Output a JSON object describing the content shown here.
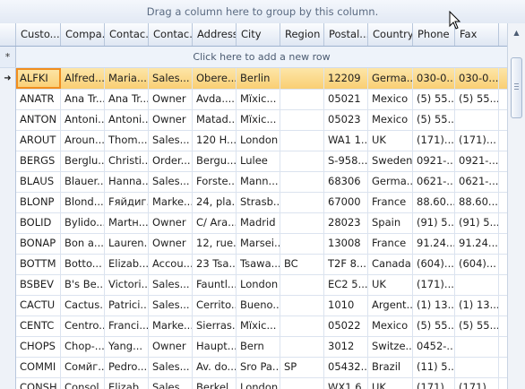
{
  "group_panel_text": "Drag a column here to group by this column.",
  "new_row_text": "Click here to add a new row",
  "new_row_symbol": "*",
  "current_row_symbol": "➜",
  "columns": [
    "Custo...",
    "Compa...",
    "Contac...",
    "Contac...",
    "Address",
    "City",
    "Region",
    "Postal...",
    "Country",
    "Phone",
    "Fax"
  ],
  "rows": [
    [
      "ALFKI",
      "Alfred...",
      "Maria...",
      "Sales...",
      "Obere...",
      "Berlin",
      "",
      "12209",
      "Germa...",
      "030-0...",
      "030-0..."
    ],
    [
      "ANATR",
      "Ana Tr...",
      "Ana Tr...",
      "Owner",
      "Avda....",
      "Мїхіс...",
      "",
      "05021",
      "Mexico",
      "(5) 55...",
      "(5) 55..."
    ],
    [
      "ANTON",
      "Antoni...",
      "Antoni...",
      "Owner",
      "Matad...",
      "Мїхіс...",
      "",
      "05023",
      "Mexico",
      "(5) 55...",
      ""
    ],
    [
      "AROUT",
      "Aroun...",
      "Thom...",
      "Sales...",
      "120 H...",
      "London",
      "",
      "WA1 1...",
      "UK",
      "(171)...",
      "(171)..."
    ],
    [
      "BERGS",
      "Berglu...",
      "Christi...",
      "Order...",
      "Bergu...",
      "Lulee",
      "",
      "S-958...",
      "Sweden",
      "0921-...",
      "0921-..."
    ],
    [
      "BLAUS",
      "Blauer...",
      "Hanna...",
      "Sales...",
      "Forste...",
      "Mann...",
      "",
      "68306",
      "Germa...",
      "0621-...",
      "0621-..."
    ],
    [
      "BLONP",
      "Blond...",
      "Fяйдиг...",
      "Marke...",
      "24, pla...",
      "Strasb...",
      "",
      "67000",
      "France",
      "88.60....",
      "88.60...."
    ],
    [
      "BOLID",
      "Bylido...",
      "Мartн...",
      "Owner",
      "C/ Ara...",
      "Madrid",
      "",
      "28023",
      "Spain",
      "(91) 5...",
      "(91) 5..."
    ],
    [
      "BONAP",
      "Bon a...",
      "Lauren...",
      "Owner",
      "12, rue...",
      "Marsei...",
      "",
      "13008",
      "France",
      "91.24....",
      "91.24...."
    ],
    [
      "BOTTM",
      "Botto...",
      "Elizab...",
      "Accou...",
      "23 Tsa...",
      "Tsawa...",
      "BC",
      "T2F 8...",
      "Canada",
      "(604)...",
      "(604)..."
    ],
    [
      "BSBEV",
      "B's Be...",
      "Victori...",
      "Sales...",
      "Fauntl...",
      "London",
      "",
      "EC2 5...",
      "UK",
      "(171)...",
      ""
    ],
    [
      "CACTU",
      "Cactus...",
      "Patrici...",
      "Sales...",
      "Cerrito...",
      "Bueno...",
      "",
      "1010",
      "Argent...",
      "(1) 13...",
      "(1) 13..."
    ],
    [
      "CENTC",
      "Centro...",
      "Franci...",
      "Marke...",
      "Sierras...",
      "Мїхіс...",
      "",
      "05022",
      "Mexico",
      "(5) 55...",
      "(5) 55..."
    ],
    [
      "CHOPS",
      "Chop-...",
      "Yang...",
      "Owner",
      "Haupt...",
      "Bern",
      "",
      "3012",
      "Switze...",
      "0452-...",
      ""
    ],
    [
      "COMMI",
      "Сомйг...",
      "Pedro...",
      "Sales...",
      "Av. do...",
      "Sro Pa...",
      "SP",
      "05432...",
      "Brazil",
      "(11) 5...",
      ""
    ],
    [
      "CONSH",
      "Consol...",
      "Elizab...",
      "Sales...",
      "Berkel...",
      "London",
      "",
      "WX1 6...",
      "UK",
      "(171)...",
      "(171)..."
    ]
  ]
}
